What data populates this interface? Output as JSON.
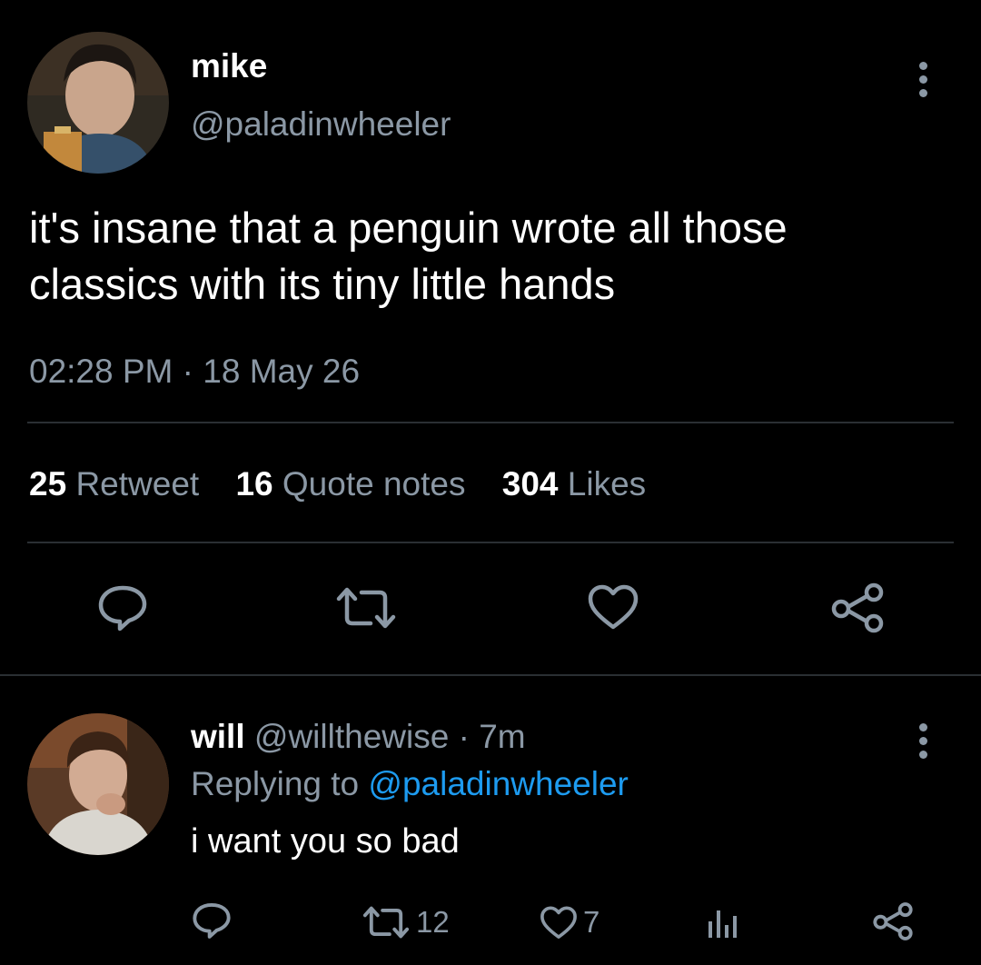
{
  "tweet": {
    "display_name": "mike",
    "handle": "@paladinwheeler",
    "text_line1": "it's insane that a penguin wrote all those",
    "text_line2": "classics with its tiny little hands",
    "time": "02:28 PM",
    "separator": "·",
    "date": "18 May 26",
    "stats": {
      "retweets": "25",
      "retweets_label": "Retweet",
      "quotes": "16",
      "quotes_label": "Quote notes",
      "likes": "304",
      "likes_label": "Likes"
    },
    "actions": [
      "reply-icon",
      "retweet-icon",
      "heart-icon",
      "share-icon"
    ]
  },
  "reply": {
    "display_name": "will",
    "handle": "@willthewise",
    "separator": "·",
    "age": "7m",
    "replying_prefix": "Replying to",
    "replying_handle": "@paladinwheeler",
    "text": "i want you so bad",
    "retweet_count": "12",
    "like_count": "7",
    "actions": [
      "reply-icon",
      "retweet-icon",
      "heart-icon",
      "analytics-icon",
      "share-icon"
    ]
  },
  "colors": {
    "background": "#000000",
    "primary_text": "#ffffff",
    "secondary_text": "#8b98a5",
    "link": "#1d9bf0",
    "divider": "#2a2f33"
  }
}
